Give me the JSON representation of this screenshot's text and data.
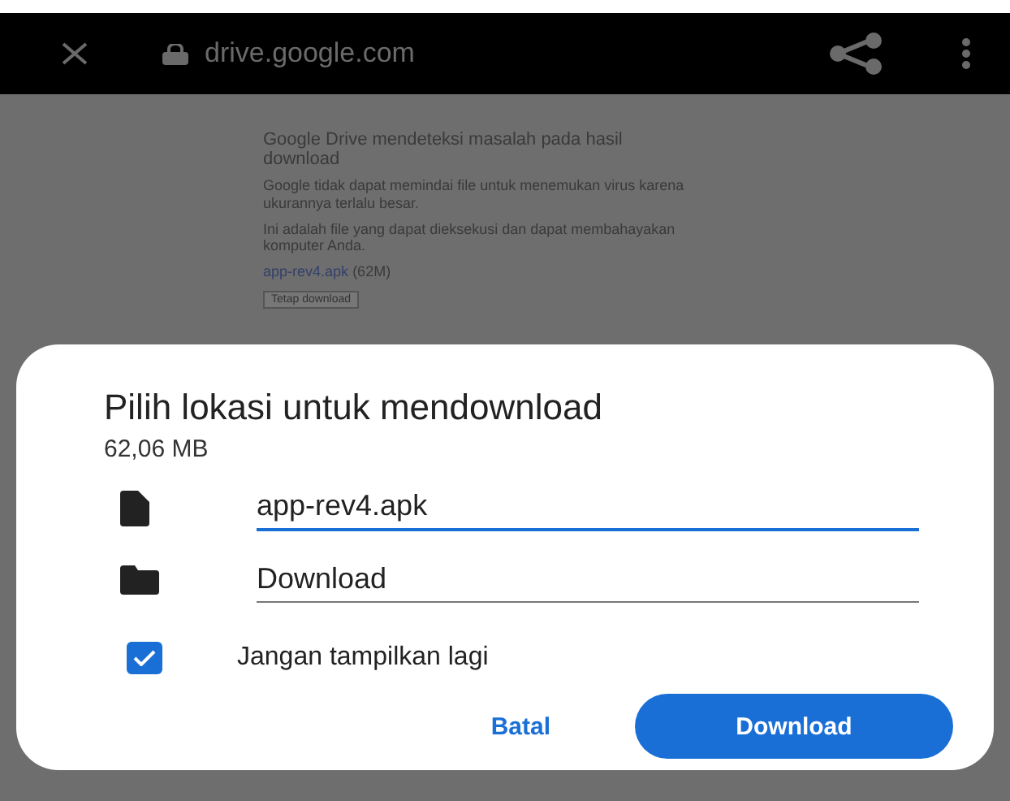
{
  "toolbar": {
    "url": "drive.google.com"
  },
  "page": {
    "heading": "Google Drive mendeteksi masalah pada hasil download",
    "paragraphs": [
      "Google tidak dapat memindai file untuk menemukan virus karena ukurannya terlalu besar.",
      "Ini adalah file yang dapat dieksekusi dan dapat membahayakan komputer Anda."
    ],
    "file_link": "app-rev4.apk",
    "file_size": "(62M)",
    "button": "Tetap download"
  },
  "dialog": {
    "title": "Pilih lokasi untuk mendownload",
    "size": "62,06 MB",
    "fields": [
      {
        "kind": "file",
        "value": "app-rev4.apk",
        "focused": true
      },
      {
        "kind": "folder",
        "value": "Download",
        "focused": false
      }
    ],
    "checkbox": {
      "label": "Jangan tampilkan lagi",
      "checked": true
    },
    "buttons": [
      {
        "label": "Batal",
        "kind": "text"
      },
      {
        "label": "Download",
        "kind": "filled"
      }
    ]
  }
}
